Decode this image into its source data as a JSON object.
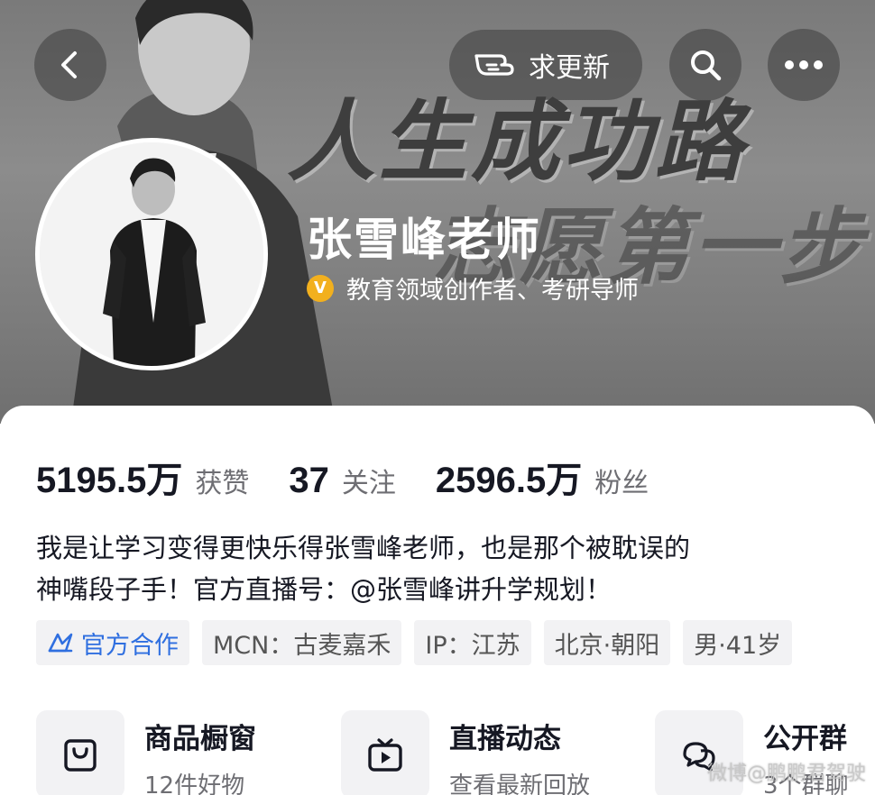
{
  "header": {
    "slogan_line1": "人生成功路",
    "slogan_line2": "志愿第一步",
    "update_button": "求更新",
    "back_icon": "back-arrow-icon",
    "search_icon": "search-icon",
    "more_icon": "more-dots-icon"
  },
  "profile": {
    "name": "张雪峰老师",
    "verification": "教育领域创作者、考研导师",
    "verify_badge": "V",
    "verify_color": "#f2b01e"
  },
  "stats": [
    {
      "value": "5195.5万",
      "label": "获赞"
    },
    {
      "value": "37",
      "label": "关注"
    },
    {
      "value": "2596.5万",
      "label": "粉丝"
    }
  ],
  "bio": {
    "line1": "我是让学习变得更快乐得张雪峰老师，也是那个被耽误的",
    "line2": "神嘴段子手！官方直播号：@张雪峰讲升学规划！"
  },
  "tags": {
    "official": "官方合作",
    "mcn": "MCN：古麦嘉禾",
    "ip": "IP：江苏",
    "location": "北京·朝阳",
    "gender_age": "男·41岁",
    "official_color": "#2f6fe0"
  },
  "entries": [
    {
      "title": "商品橱窗",
      "subtitle": "12件好物",
      "icon": "shopping-bag-icon"
    },
    {
      "title": "直播动态",
      "subtitle": "查看最新回放",
      "icon": "tv-icon"
    },
    {
      "title": "公开群",
      "subtitle": "3个群聊",
      "icon": "chat-bubbles-icon"
    }
  ],
  "watermark": "微博@鹏鹏君驾驶"
}
